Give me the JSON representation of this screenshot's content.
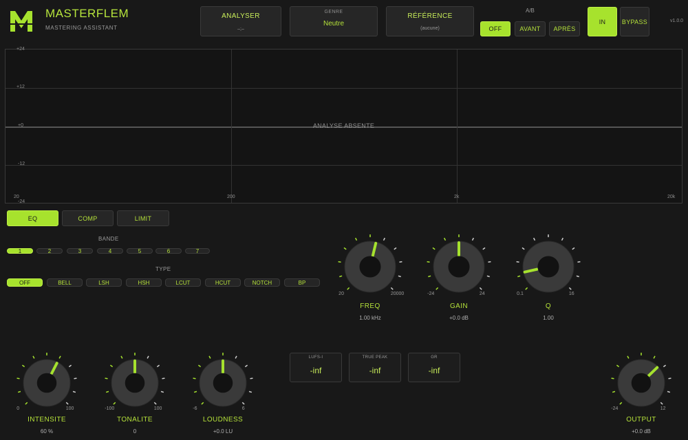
{
  "brand": {
    "title": "MASTERFLEM",
    "subtitle": "MASTERING ASSISTANT",
    "accent": "#a6e22e"
  },
  "topbar": {
    "analyser": {
      "label": "ANALYSER",
      "value": "–;–"
    },
    "genre": {
      "label": "GENRE",
      "value": "Neutre"
    },
    "reference": {
      "label": "RÉFÉRENCE",
      "value": "(aucune)"
    },
    "ab": {
      "label": "A/B",
      "off": "OFF",
      "before": "AVANT",
      "after": "APRÈS",
      "selected": "OFF"
    },
    "in_label": "IN",
    "bypass_label": "BYPASS",
    "version": "v1.0.0"
  },
  "analyser": {
    "y_labels": [
      "+24",
      "+12",
      "+0",
      "-12",
      "-24"
    ],
    "x_labels": [
      "20",
      "200",
      "2k",
      "20k"
    ],
    "status": "ANALYSE ABSENTE"
  },
  "tabs": [
    "EQ",
    "COMP",
    "LIMIT"
  ],
  "active_tab": "EQ",
  "bands": {
    "label": "BANDE",
    "items": [
      "1",
      "2",
      "3",
      "4",
      "5",
      "6",
      "7"
    ],
    "selected": "1"
  },
  "types": {
    "label": "TYPE",
    "items": [
      "OFF",
      "BELL",
      "LSH",
      "HSH",
      "LCUT",
      "HCUT",
      "NOTCH",
      "BP"
    ],
    "selected": "OFF"
  },
  "eq_knobs": [
    {
      "id": "freq",
      "label": "FREQ",
      "value": "1.00 kHz",
      "min": "20",
      "max": "20000",
      "position": 0.55
    },
    {
      "id": "gain",
      "label": "GAIN",
      "value": "+0.0 dB",
      "min": "-24",
      "max": "24",
      "position": 0.5
    },
    {
      "id": "q",
      "label": "Q",
      "value": "1.00",
      "min": "0.1",
      "max": "16",
      "position": 0.12
    }
  ],
  "macro_knobs": [
    {
      "id": "intensite",
      "label": "INTENSITE",
      "value": "60 %",
      "min": "0",
      "max": "100",
      "position": 0.6
    },
    {
      "id": "tonalite",
      "label": "TONALITE",
      "value": "0",
      "min": "-100",
      "max": "100",
      "position": 0.5
    },
    {
      "id": "loudness",
      "label": "LOUDNESS",
      "value": "+0.0 LU",
      "min": "-6",
      "max": "6",
      "position": 0.5
    }
  ],
  "meters": [
    {
      "label": "LUFS-I",
      "value": "-inf"
    },
    {
      "label": "TRUE PEAK",
      "value": "-inf"
    },
    {
      "label": "GR",
      "value": "-inf"
    }
  ],
  "output": {
    "label": "OUTPUT",
    "value": "+0.0 dB",
    "min": "-24",
    "max": "12",
    "position": 0.67
  }
}
